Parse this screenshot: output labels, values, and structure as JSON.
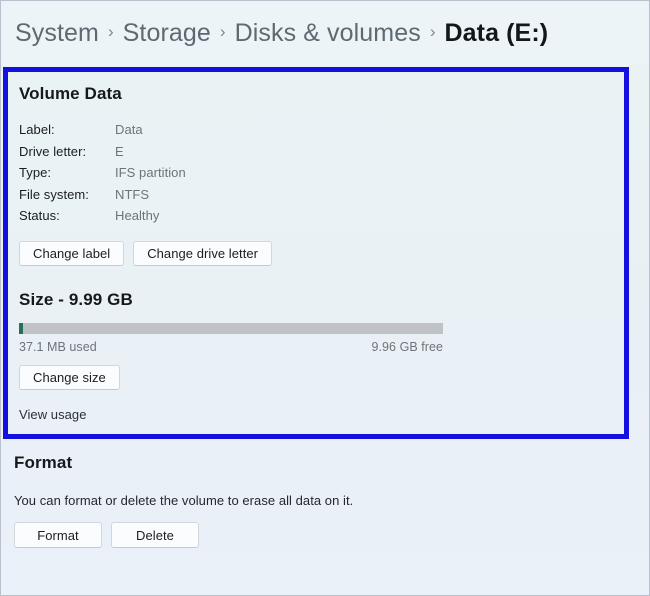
{
  "breadcrumb": {
    "separator": "›",
    "items": [
      {
        "label": "System",
        "current": false
      },
      {
        "label": "Storage",
        "current": false
      },
      {
        "label": "Disks & volumes",
        "current": false
      },
      {
        "label": "Data (E:)",
        "current": true
      }
    ]
  },
  "highlight": {
    "border_color": "#1410e0"
  },
  "volume": {
    "title": "Volume Data",
    "properties": [
      {
        "label": "Label:",
        "value": "Data"
      },
      {
        "label": "Drive letter:",
        "value": "E"
      },
      {
        "label": "Type:",
        "value": "IFS partition"
      },
      {
        "label": "File system:",
        "value": "NTFS"
      },
      {
        "label": "Status:",
        "value": "Healthy"
      }
    ],
    "change_label_button": "Change label",
    "change_drive_letter_button": "Change drive letter"
  },
  "size": {
    "title": "Size - 9.99 GB",
    "used_text": "37.1 MB used",
    "free_text": "9.96 GB free",
    "used_percent": 0.4,
    "used_color": "#2c6b5f",
    "track_color": "#bfc3c7",
    "change_size_button": "Change size",
    "view_usage_link": "View usage"
  },
  "format": {
    "title": "Format",
    "description": "You can format or delete the volume to erase all data on it.",
    "format_button": "Format",
    "delete_button": "Delete"
  }
}
